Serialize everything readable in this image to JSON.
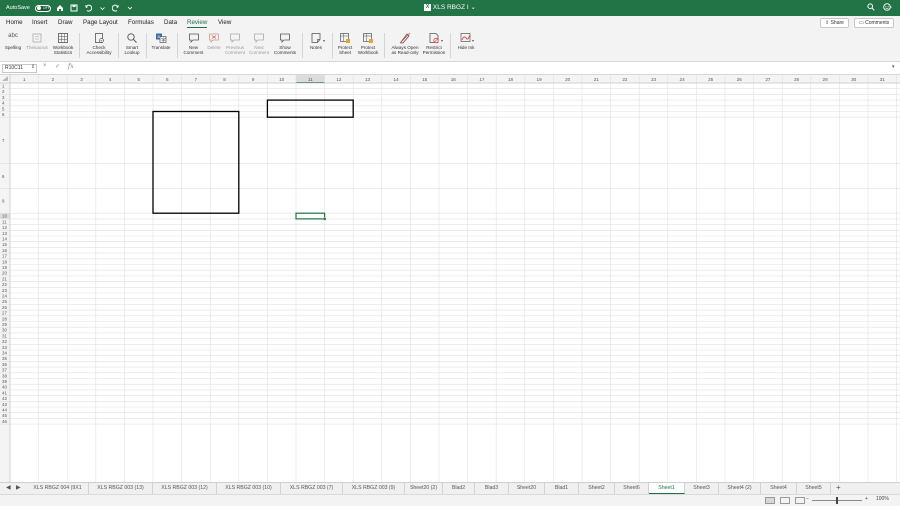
{
  "titlebar": {
    "autosave_label": "AutoSave",
    "autosave_state": "OFF",
    "title": "XLS RBGZ I",
    "title_chevron": "⌄",
    "icons": [
      "home-icon",
      "save-icon",
      "undo-icon",
      "redo-icon",
      "more-icon"
    ]
  },
  "ribbon_tabs": [
    "Home",
    "Insert",
    "Draw",
    "Page Layout",
    "Formulas",
    "Data",
    "Review",
    "View"
  ],
  "active_tab": "Review",
  "ribbon_right": {
    "share": "Share",
    "comments": "Comments"
  },
  "ribbon": {
    "spelling": "Spelling",
    "thesaurus": "Thesaurus",
    "workbook_statistics_1": "Workbook",
    "workbook_statistics_2": "Statistics",
    "check_accessibility_1": "Check",
    "check_accessibility_2": "Accessibility",
    "smart_lookup_1": "Smart",
    "smart_lookup_2": "Lookup",
    "translate": "Translate",
    "new_comment_1": "New",
    "new_comment_2": "Comment",
    "delete": "Delete",
    "previous_comment_1": "Previous",
    "previous_comment_2": "Comment",
    "next_comment_1": "Next",
    "next_comment_2": "Comment",
    "show_comments_1": "Show",
    "show_comments_2": "Comments",
    "notes": "Notes",
    "protect_sheet_1": "Protect",
    "protect_sheet_2": "Sheet",
    "protect_workbook_1": "Protect",
    "protect_workbook_2": "Workbook",
    "always_open_1": "Always Open",
    "always_open_2": "as Read-only",
    "restrict_permission_1": "Restrict",
    "restrict_permission_2": "Permission",
    "hide_ink": "Hide Ink",
    "spelling_icon_text": "abc"
  },
  "formula_bar": {
    "name_box": "R10C11",
    "fx": "fx",
    "cancel": "×",
    "enter": "✓",
    "value": ""
  },
  "grid": {
    "columns": [
      "1",
      "2",
      "3",
      "4",
      "5",
      "6",
      "7",
      "8",
      "9",
      "10",
      "11",
      "12",
      "13",
      "14",
      "15",
      "16",
      "17",
      "18",
      "19",
      "20",
      "21",
      "22",
      "23",
      "24",
      "25",
      "26",
      "27",
      "28",
      "29",
      "30",
      "31"
    ],
    "rows": [
      "1",
      "2",
      "3",
      "4",
      "5",
      "6",
      "7",
      "8",
      "9",
      "10",
      "11",
      "12",
      "13",
      "14",
      "15",
      "16",
      "17",
      "18",
      "19",
      "20",
      "21",
      "22",
      "23",
      "24",
      "25",
      "26",
      "27",
      "28",
      "29",
      "30",
      "31",
      "32",
      "33",
      "34",
      "35",
      "36",
      "37",
      "38",
      "39",
      "40",
      "41",
      "42",
      "43",
      "44",
      "45",
      "46"
    ],
    "selected_cell": {
      "row": 10,
      "col": 11
    },
    "bordered_ranges": [
      {
        "row_start": 6,
        "row_end": 9,
        "col_start": 6,
        "col_end": 8
      },
      {
        "row_start": 4,
        "row_end": 6,
        "col_start": 10,
        "col_end": 12
      }
    ]
  },
  "sheet_tabs": [
    "XLS RBGZ 004 (9X1",
    "XLS RBGZ 003 (13)",
    "XLS RBGZ 003 (12)",
    "XLS RBGZ 003 (10)",
    "XLS RBGZ 003 (7)",
    "XLS RBGZ 003 (9)",
    "Sheet20 (2)",
    "Blad2",
    "Blad3",
    "Sheet20",
    "Blad1",
    "Sheet2",
    "Sheet6",
    "Sheet1",
    "Sheet3",
    "Sheet4 (2)",
    "Sheet4",
    "Sheet5"
  ],
  "active_sheet": "Sheet1",
  "status_bar": {
    "zoom": "100%",
    "zoom_minus": "−",
    "zoom_plus": "+"
  }
}
